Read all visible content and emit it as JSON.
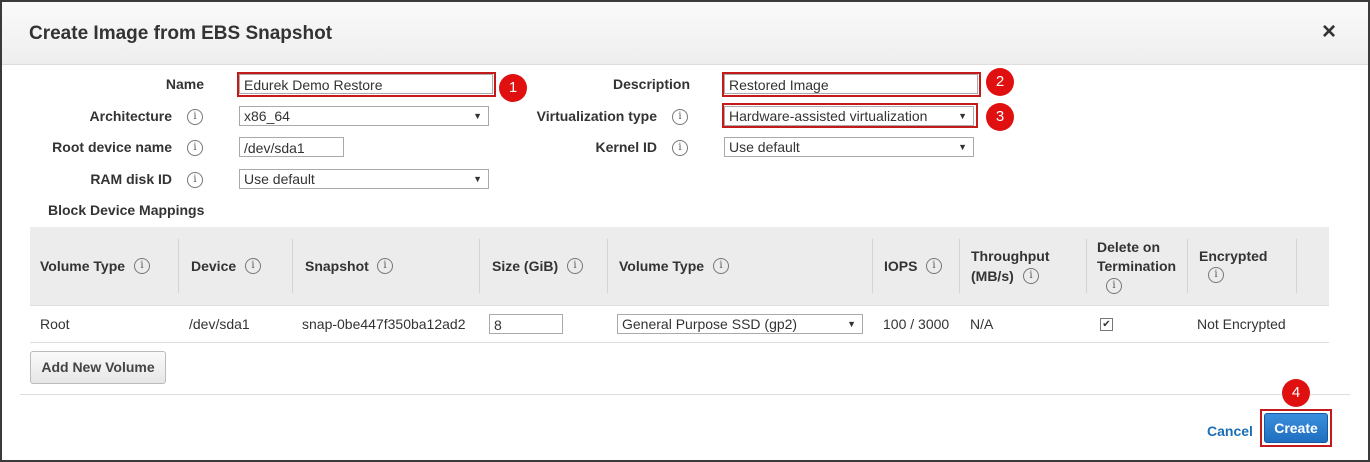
{
  "dialog": {
    "title": "Create Image from EBS Snapshot",
    "close_icon": "×"
  },
  "form": {
    "name_label": "Name",
    "name_value": "Edurek Demo Restore",
    "description_label": "Description",
    "description_value": "Restored Image",
    "architecture_label": "Architecture",
    "architecture_value": "x86_64",
    "virtualization_label": "Virtualization type",
    "virtualization_value": "Hardware-assisted virtualization",
    "root_device_label": "Root device name",
    "root_device_value": "/dev/sda1",
    "kernel_label": "Kernel ID",
    "kernel_value": "Use default",
    "ramdisk_label": "RAM disk ID",
    "ramdisk_value": "Use default",
    "block_mappings_label": "Block Device Mappings"
  },
  "table": {
    "headers": {
      "volume_type": "Volume Type",
      "device": "Device",
      "snapshot": "Snapshot",
      "size": "Size (GiB)",
      "volume_type2": "Volume Type",
      "iops": "IOPS",
      "throughput_l1": "Throughput",
      "throughput_l2": "(MB/s)",
      "delete_l1": "Delete on",
      "delete_l2": "Termination",
      "encrypted": "Encrypted"
    },
    "row": {
      "volume_type": "Root",
      "device": "/dev/sda1",
      "snapshot": "snap-0be447f350ba12ad2",
      "size": "8",
      "ebs_type": "General Purpose SSD (gp2)",
      "iops": "100 / 3000",
      "throughput": "N/A",
      "delete_on_termination": "✔",
      "encrypted": "Not Encrypted"
    }
  },
  "buttons": {
    "add_volume": "Add New Volume",
    "cancel": "Cancel",
    "create": "Create"
  },
  "badges": [
    "1",
    "2",
    "3",
    "4"
  ],
  "icons": {
    "info": "i",
    "dropdown": "▼"
  },
  "colors": {
    "highlight": "#c41a1a",
    "badge": "#e01010",
    "primary": "#1f6fc0",
    "link": "#1a6fb5"
  }
}
